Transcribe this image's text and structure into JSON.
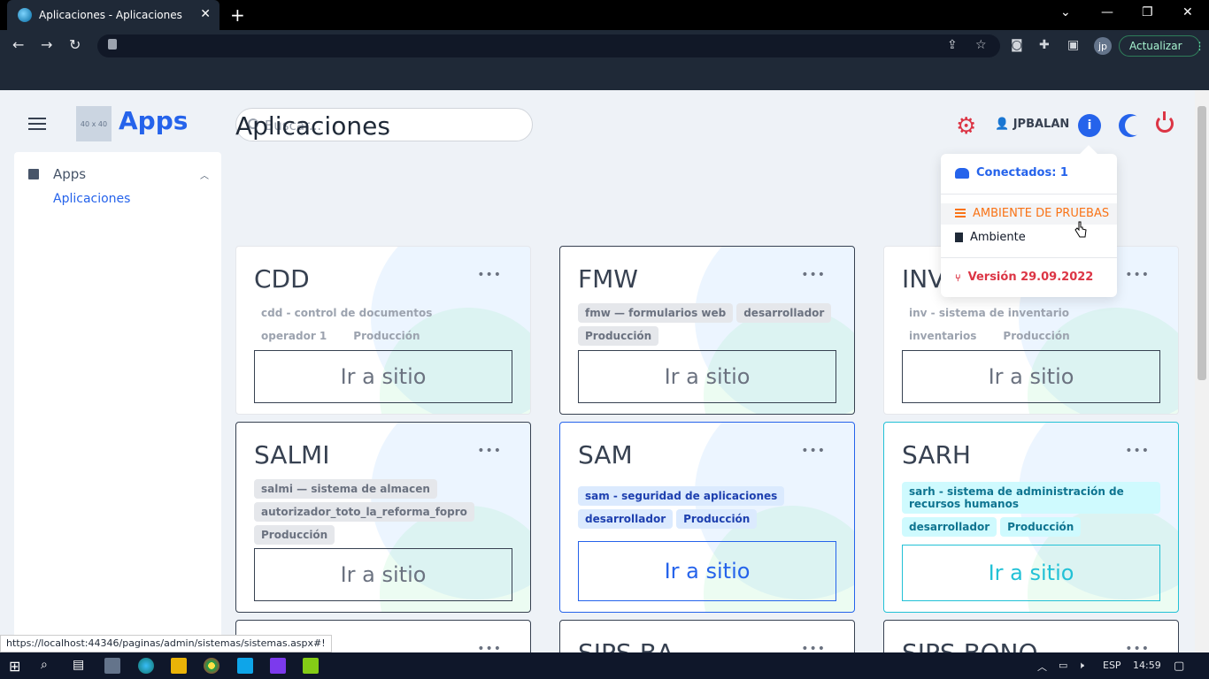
{
  "browser": {
    "tab_title": "Aplicaciones - Aplicaciones",
    "update_label": "Actualizar",
    "profile_initials": "jp",
    "status_url": "https://localhost:44346/paginas/admin/sistemas/sistemas.aspx#!"
  },
  "header": {
    "logo_placeholder": "40 x 40",
    "brand": "Apps",
    "search_placeholder": "Buscar...",
    "username": "JPBALAN"
  },
  "sidebar": {
    "group_label": "Apps",
    "items": [
      {
        "label": "Aplicaciones"
      }
    ]
  },
  "main": {
    "title": "Aplicaciones",
    "cards": [
      {
        "name": "CDD",
        "tags": [
          "cdd - control de documentos",
          "operador 1",
          "Producción"
        ],
        "button": "Ir a sitio"
      },
      {
        "name": "FMW",
        "tags": [
          "fmw — formularios web",
          "desarrollador",
          "Producción"
        ],
        "button": "Ir a sitio"
      },
      {
        "name": "INV",
        "tags": [
          "inv - sistema de inventario",
          "inventarios",
          "Producción"
        ],
        "button": "Ir a sitio"
      },
      {
        "name": "SALMI",
        "tags": [
          "salmi — sistema de almacen",
          "autorizador_toto_la_reforma_fopro",
          "Producción"
        ],
        "button": "Ir a sitio"
      },
      {
        "name": "SAM",
        "tags": [
          "sam - seguridad de aplicaciones",
          "desarrollador",
          "Producción"
        ],
        "button": "Ir a sitio"
      },
      {
        "name": "SARH",
        "tags": [
          "sarh - sistema de administración de recursos humanos",
          "desarrollador",
          "Producción"
        ],
        "button": "Ir a sitio"
      },
      {
        "name": "SIPS-BA"
      },
      {
        "name": "SIPS-BONO"
      }
    ]
  },
  "dropdown": {
    "connected": "Conectados: 1",
    "env_test": "AMBIENTE DE PRUEBAS",
    "env": "Ambiente",
    "version": "Versión 29.09.2022"
  },
  "taskbar": {
    "lang": "ESP",
    "time": "14:59"
  },
  "colors": {
    "accent": "#2563eb",
    "danger": "#dc3545",
    "warning": "#f97316",
    "cyan": "#22c1d6"
  }
}
